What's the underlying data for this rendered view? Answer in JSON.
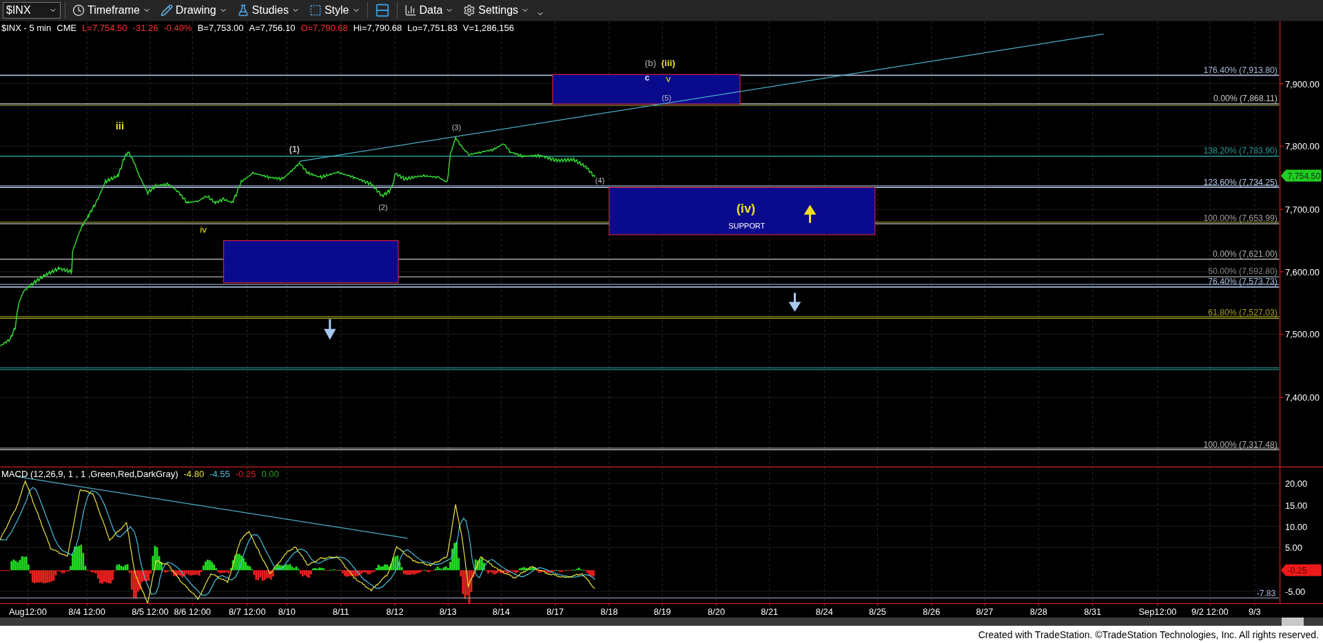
{
  "toolbar": {
    "symbol": "$INX",
    "menus": [
      {
        "label": "Timeframe"
      },
      {
        "label": "Drawing"
      },
      {
        "label": "Studies"
      },
      {
        "label": "Style"
      },
      {
        "label": "Data"
      },
      {
        "label": "Settings"
      }
    ]
  },
  "quote_header": [
    {
      "text": "$INX - 5 min",
      "color": "#ffffff"
    },
    {
      "text": "CME",
      "color": "#ffffff"
    },
    {
      "text": "L=7,754.50",
      "color": "#ff3030"
    },
    {
      "text": "-31.26",
      "color": "#ff3030"
    },
    {
      "text": "-0.40%",
      "color": "#ff3030"
    },
    {
      "text": "B=7,753.00",
      "color": "#ffffff"
    },
    {
      "text": "A=7,756.10",
      "color": "#ffffff"
    },
    {
      "text": "O=7,790.68",
      "color": "#ff3030"
    },
    {
      "text": "Hi=7,790.68",
      "color": "#ffffff"
    },
    {
      "text": "Lo=7,751.83",
      "color": "#ffffff"
    },
    {
      "text": "V=1,286,156",
      "color": "#ffffff"
    }
  ],
  "fib_levels": [
    {
      "label": "176.40% (7,913.80)",
      "color": "#a9b8d8"
    },
    {
      "label": "0.00% (7,868.11)",
      "color": "#c8c8c8"
    },
    {
      "label": "138.20% (7,783.90)",
      "color": "#2a9c9c"
    },
    {
      "label": "123.60% (7,734.25)",
      "color": "#b8c8e8"
    },
    {
      "label": "100.00% (7,653.99)",
      "color": "#a0a0a0"
    },
    {
      "label": "0.00% (7,621.00)",
      "color": "#b0b0b0"
    },
    {
      "label": "50.00% (7,592.80)",
      "color": "#808080"
    },
    {
      "label": "76.40% (7,573.73)",
      "color": "#a8c0e0"
    },
    {
      "label": "61.80% (7,527.03)",
      "color": "#a0a020"
    },
    {
      "label": "100.00% (7,317.48)",
      "color": "#b0b0b0"
    }
  ],
  "price_axis": [
    "7,900.00",
    "7,800.00",
    "7,700.00",
    "7,600.00",
    "7,500.00",
    "7,400.00"
  ],
  "last_price": "7,754.50",
  "wave_labels": [
    {
      "text": "(b)",
      "color": "#b0b0b0"
    },
    {
      "text": "(iii)",
      "color": "#e8e020"
    },
    {
      "text": "c",
      "color": "#d8e8ff"
    },
    {
      "text": "v",
      "color": "#e8e020"
    },
    {
      "text": "(5)",
      "color": "#c0c0c0"
    },
    {
      "text": "iii",
      "color": "#e8e020"
    },
    {
      "text": "iv",
      "color": "#e8e020"
    },
    {
      "text": "(1)",
      "color": "#c0c0c0"
    },
    {
      "text": "(2)",
      "color": "#c0c0c0"
    },
    {
      "text": "(3)",
      "color": "#c0c0c0"
    },
    {
      "text": "(4)",
      "color": "#c0c0c0"
    }
  ],
  "support_zone": {
    "wave": "(iv)",
    "label": "SUPPORT"
  },
  "macd": {
    "title": "MACD (12,26,9, 1 , 1 ,Green,Red,DarkGray)",
    "values": [
      {
        "text": "-4.80",
        "color": "#e8e23c"
      },
      {
        "text": "-4.55",
        "color": "#4ac0e0"
      },
      {
        "text": "-0.25",
        "color": "#e02020"
      },
      {
        "text": "0.00",
        "color": "#20a020"
      }
    ],
    "axis": [
      "20.00",
      "15.00",
      "10.00",
      "5.00",
      "-5.00"
    ],
    "last": "-0.25",
    "low": "-7.83"
  },
  "date_axis": [
    "Aug12:00",
    "8/4 12:00",
    "8/5 12:00",
    "8/6 12:00",
    "8/7 12:00",
    "8/10",
    "8/11",
    "8/12",
    "8/13",
    "8/14",
    "8/17",
    "8/18",
    "8/19",
    "8/20",
    "8/21",
    "8/24",
    "8/25",
    "8/26",
    "8/27",
    "8/28",
    "8/31",
    "Sep12:00",
    "9/2 12:00",
    "9/3"
  ],
  "footer": "Created with TradeStation. ©TradeStation Technologies, Inc. All rights reserved."
}
